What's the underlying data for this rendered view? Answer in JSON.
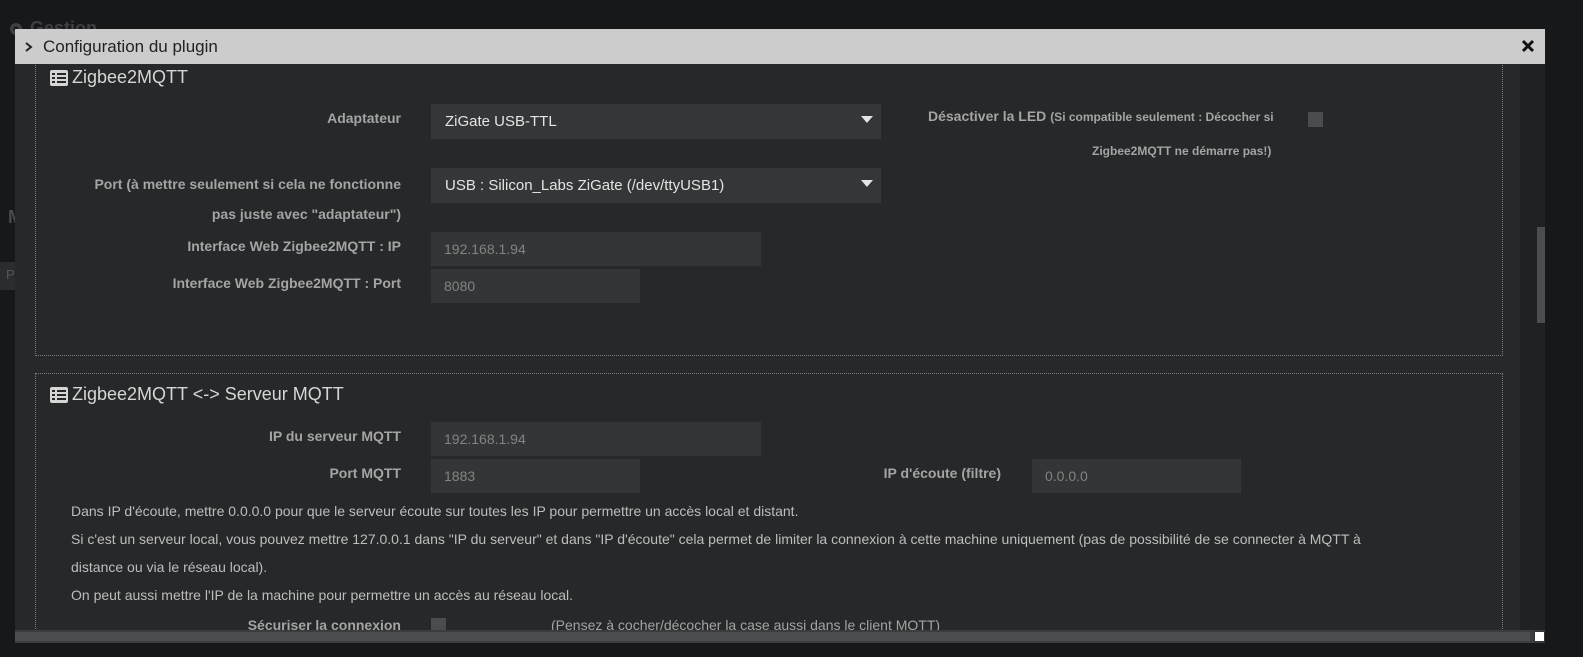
{
  "background": {
    "title": "Gestion",
    "letter": "M",
    "bar_letter": "P"
  },
  "modal": {
    "title": "Configuration du plugin"
  },
  "section1": {
    "legend": "Zigbee2MQTT",
    "adapter_label": "Adaptateur",
    "adapter_value": "ZiGate USB-TTL",
    "led_label": "Désactiver la LED",
    "led_note": "(Si compatible seulement : Décocher si Zigbee2MQTT ne démarre pas!)",
    "led_note_line1": "(Si compatible seulement : Décocher si",
    "led_note_line2": "Zigbee2MQTT ne démarre pas!)",
    "port_label_line1": "Port (à mettre seulement si cela ne fonctionne",
    "port_label_line2": "pas juste avec \"adaptateur\")",
    "port_value": "USB : Silicon_Labs ZiGate (/dev/ttyUSB1)",
    "web_ip_label": "Interface Web Zigbee2MQTT : IP",
    "web_ip_value": "192.168.1.94",
    "web_port_label": "Interface Web Zigbee2MQTT : Port",
    "web_port_value": "8080"
  },
  "section2": {
    "legend": "Zigbee2MQTT <-> Serveur MQTT",
    "mqtt_ip_label": "IP du serveur MQTT",
    "mqtt_ip_value": "192.168.1.94",
    "mqtt_port_label": "Port MQTT",
    "mqtt_port_value": "1883",
    "listen_ip_label": "IP d'écoute (filtre)",
    "listen_ip_value": "0.0.0.0",
    "para1": "Dans IP d'écoute, mettre 0.0.0.0 pour que le serveur écoute sur toutes les IP pour permettre un accès local et distant.",
    "para2_line1": "Si c'est un serveur local, vous pouvez mettre 127.0.0.1 dans \"IP du serveur\" et dans \"IP d'écoute\" cela permet de limiter la connexion à cette machine uniquement (pas de possibilité de se connecter à MQTT à",
    "para2_line2": "distance ou via le réseau local).",
    "para3": "On peut aussi mettre l'IP de la machine pour permettre un accès au réseau local.",
    "secure_label": "Sécuriser la connexion",
    "secure_note": "(Pensez à cocher/décocher la case aussi dans le client MQTT)"
  },
  "colors": {
    "modal_bg": "#262829",
    "header_bg": "#cccccc",
    "field_bg": "#333536"
  }
}
